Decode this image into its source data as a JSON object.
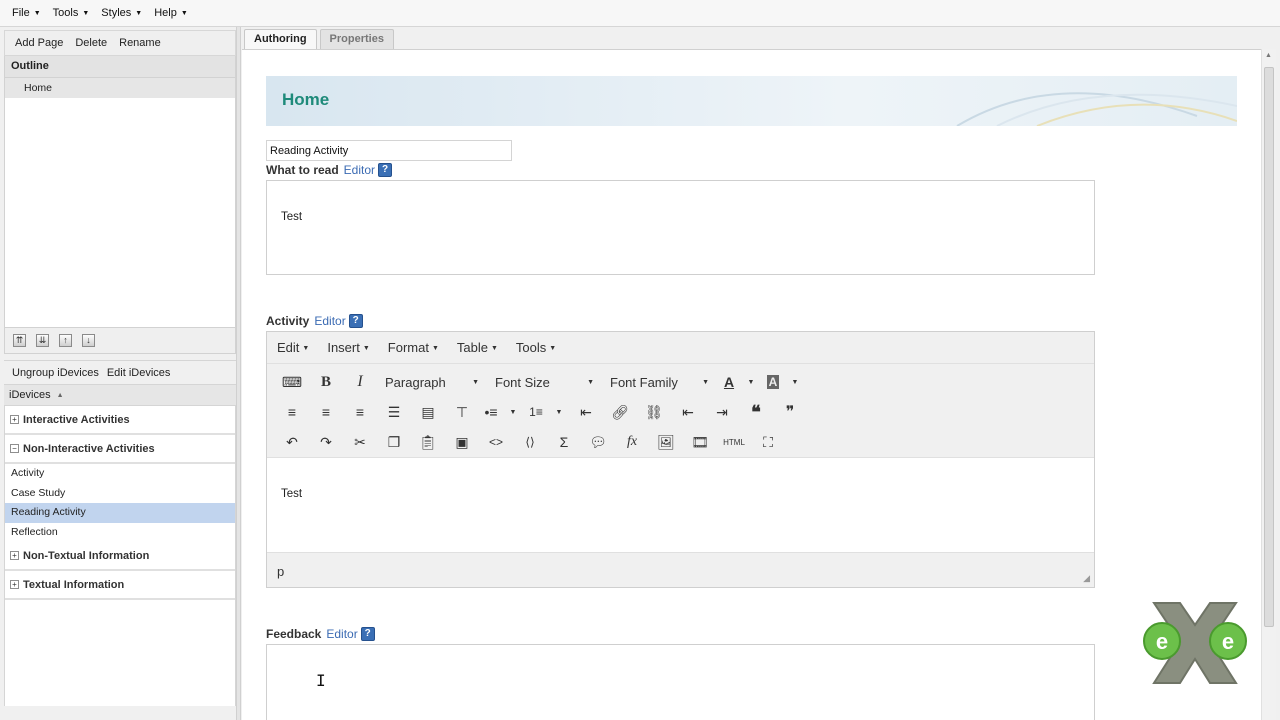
{
  "menubar": {
    "items": [
      "File",
      "Tools",
      "Styles",
      "Help"
    ]
  },
  "left_panel": {
    "page_buttons": [
      "Add Page",
      "Delete",
      "Rename"
    ],
    "outline_title": "Outline",
    "outline_items": [
      "Home"
    ],
    "idevice_buttons": [
      "Ungroup iDevices",
      "Edit iDevices"
    ],
    "idevices_title": "iDevices",
    "categories": {
      "interactive": "Interactive Activities",
      "non_interactive": "Non-Interactive Activities",
      "non_textual": "Non-Textual Information",
      "textual": "Textual Information"
    },
    "non_interactive_items": [
      "Activity",
      "Case Study",
      "Reading Activity",
      "Reflection"
    ],
    "selected_item": "Reading Activity"
  },
  "tabs": [
    "Authoring",
    "Properties"
  ],
  "main": {
    "page_title": "Home",
    "idevice_title": "Reading Activity",
    "what_to_read": {
      "label": "What to read",
      "editor_link": "Editor",
      "help": "?",
      "content": "Test"
    },
    "activity": {
      "label": "Activity",
      "editor_link": "Editor",
      "help": "?",
      "content": "Test"
    },
    "feedback": {
      "label": "Feedback",
      "editor_link": "Editor",
      "help": "?",
      "content": ""
    }
  },
  "editor": {
    "menus": [
      "Edit",
      "Insert",
      "Format",
      "Table",
      "Tools"
    ],
    "format_select": "Paragraph",
    "font_size_select": "Font Size",
    "font_family_select": "Font Family",
    "status_path": "p"
  },
  "colors": {
    "title_teal": "#1e8a7a",
    "link_blue": "#3b6bb3",
    "selected_bg": "#c1d4ee"
  }
}
